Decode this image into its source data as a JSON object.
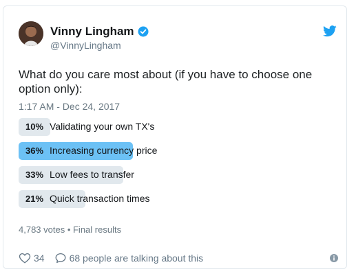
{
  "author": {
    "name": "Vinny Lingham",
    "handle": "@VinnyLingham"
  },
  "tweet": {
    "text": "What do you care most about (if you have to choose one option only):",
    "timestamp": "1:17 AM - Dec 24, 2017"
  },
  "poll": {
    "options": [
      {
        "percent": "10%",
        "fraction": 0.1,
        "label": "Validating your own TX's",
        "winner": false
      },
      {
        "percent": "36%",
        "fraction": 0.36,
        "label": "Increasing currency price",
        "winner": true
      },
      {
        "percent": "33%",
        "fraction": 0.33,
        "label": "Low fees to transfer",
        "winner": false
      },
      {
        "percent": "21%",
        "fraction": 0.21,
        "label": "Quick transaction times",
        "winner": false
      }
    ],
    "summary": "4,783 votes • Final results"
  },
  "footer": {
    "likes": "34",
    "talking": "68 people are talking about this"
  },
  "colors": {
    "winner_bar": "#6cc1f5",
    "bar": "#e1e8ed",
    "twitter_blue": "#1da1f2"
  },
  "icons": [
    "verified-icon",
    "twitter-bird-icon",
    "heart-icon",
    "comment-icon",
    "info-icon"
  ]
}
